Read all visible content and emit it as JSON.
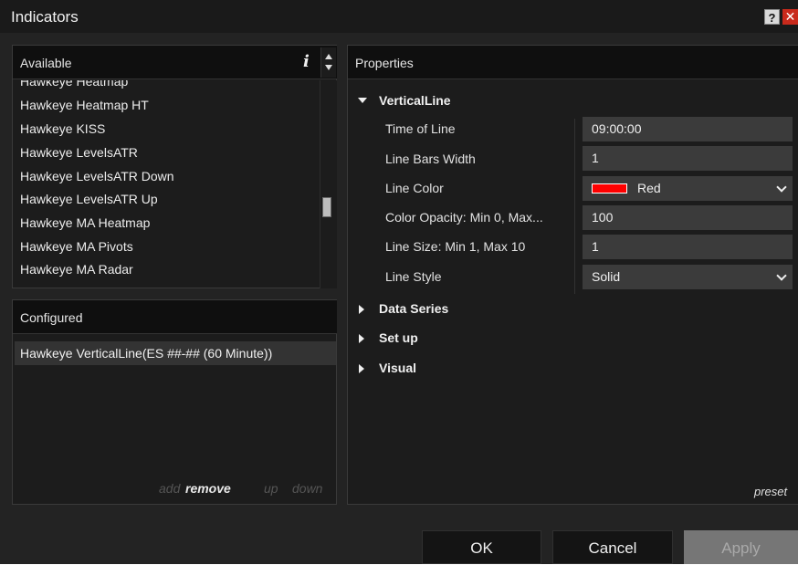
{
  "window": {
    "title": "Indicators",
    "help_glyph": "?",
    "close_glyph": "✕"
  },
  "available": {
    "label": "Available",
    "info_glyph": "i",
    "items": [
      "Hawkeye Heatmap",
      "Hawkeye Heatmap HT",
      "Hawkeye KISS",
      "Hawkeye LevelsATR",
      "Hawkeye LevelsATR Down",
      "Hawkeye LevelsATR Up",
      "Hawkeye MA Heatmap",
      "Hawkeye MA Pivots",
      "Hawkeye MA Radar"
    ]
  },
  "configured": {
    "label": "Configured",
    "items": [
      "Hawkeye VerticalLine(ES ##-## (60 Minute))"
    ],
    "actions": {
      "add": "add",
      "remove": "remove",
      "up": "up",
      "down": "down"
    }
  },
  "properties": {
    "label": "Properties",
    "section_open": "VerticalLine",
    "rows": [
      {
        "label": "Time of Line",
        "value": "09:00:00"
      },
      {
        "label": "Line Bars Width",
        "value": "1"
      },
      {
        "label": "Line Color",
        "value": "Red",
        "swatch": "#ff0000"
      },
      {
        "label": "Color Opacity: Min 0, Max...",
        "value": "100"
      },
      {
        "label": "Line Size: Min 1, Max 10",
        "value": "1"
      },
      {
        "label": "Line Style",
        "value": "Solid"
      }
    ],
    "collapsed_sections": [
      "Data Series",
      "Set up",
      "Visual"
    ],
    "preset": "preset"
  },
  "footer": {
    "ok": "OK",
    "cancel": "Cancel",
    "apply": "Apply"
  },
  "colors": {
    "background": "#232323",
    "header": "#0f0f0f",
    "field": "#3b3b3b",
    "close": "#c92a1c"
  }
}
